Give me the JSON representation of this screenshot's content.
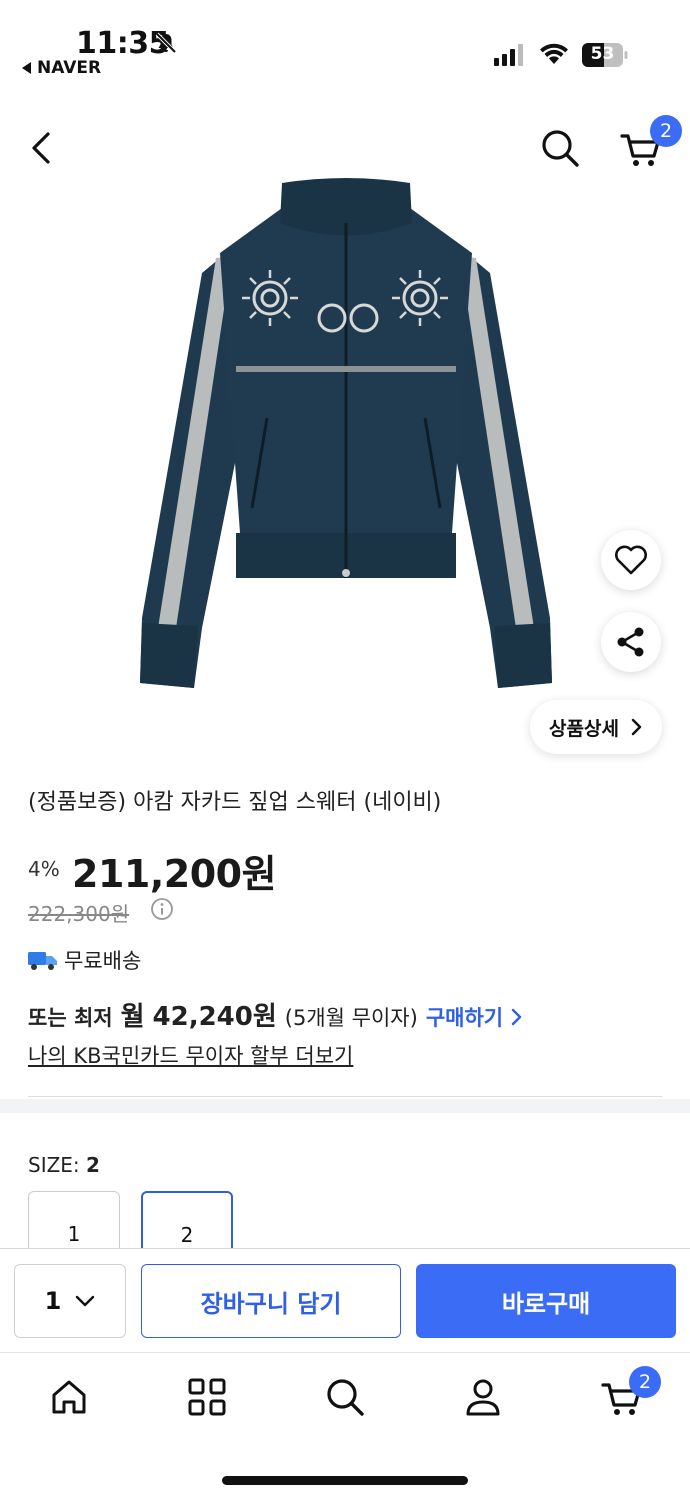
{
  "status_bar": {
    "time": "11:35",
    "back_app": "NAVER",
    "battery": "53"
  },
  "header": {
    "cart_count": "2",
    "icons": [
      "back-arrow-icon",
      "search-icon",
      "cart-icon"
    ]
  },
  "product": {
    "title": "(정품보증) 아캄 자카드 짚업 스웨터 (네이비)",
    "discount": "4%",
    "price": "211,200원",
    "original_price": "222,300원",
    "shipping": "무료배송",
    "installment": {
      "prefix": "또는 최저",
      "month_label": "월",
      "amount": "42,240원",
      "terms": "(5개월 무이자)",
      "buy_link": "구매하기"
    },
    "card_link": "나의 KB국민카드 무이자 할부 더보기",
    "detail_button": "상품상세"
  },
  "options": {
    "size_label": "SIZE:",
    "selected_size": "2",
    "sizes": [
      "1",
      "2"
    ]
  },
  "purchase_bar": {
    "quantity": "1",
    "add_to_cart": "장바구니 담기",
    "buy_now": "바로구매"
  },
  "tab_bar": {
    "cart_count": "2",
    "icons": [
      "home-icon",
      "category-grid-icon",
      "search-icon",
      "profile-icon",
      "cart-icon"
    ]
  },
  "colors": {
    "accent": "#3b6cf6",
    "link": "#2f5fe8",
    "sweater_navy": "#1f3a4e",
    "sleeve_gray": "#b9bcbc"
  }
}
